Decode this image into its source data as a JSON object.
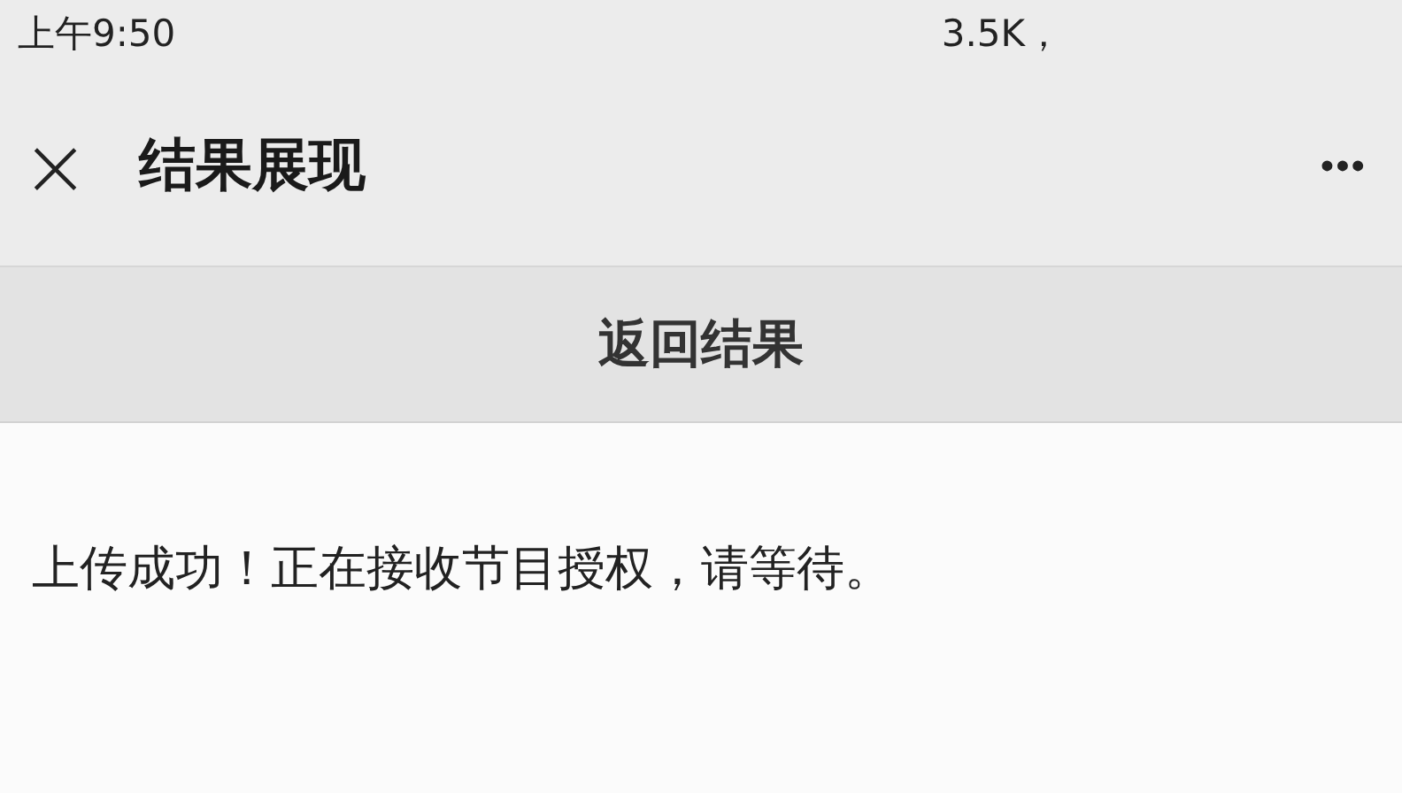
{
  "status_bar": {
    "time": "上午9:50",
    "speed": "3.5K，"
  },
  "header": {
    "close": "×",
    "title": "结果展现",
    "more": "•••"
  },
  "return_bar": {
    "label": "返回结果"
  },
  "message": "上传成功！正在接收节目授权，请等待。"
}
